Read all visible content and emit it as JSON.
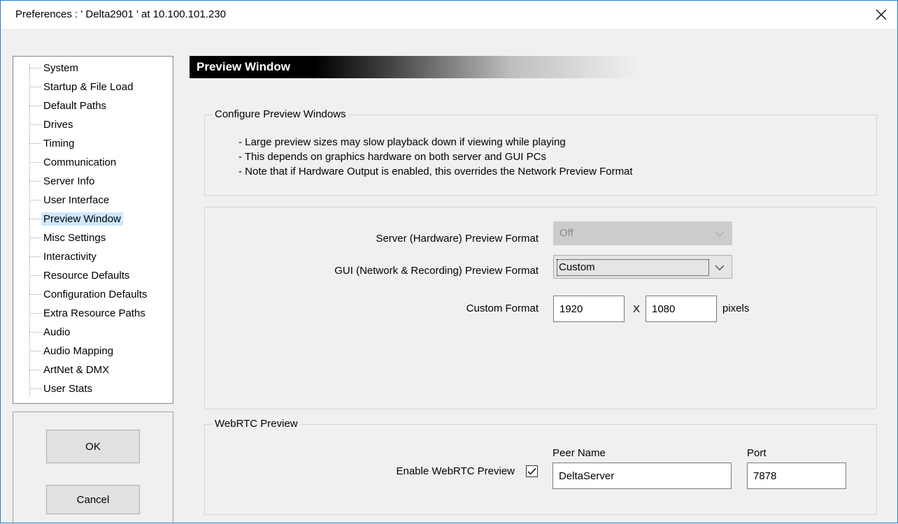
{
  "window": {
    "title": "Preferences  :  ' Delta2901 '  at  10.100.101.230"
  },
  "sidebar": {
    "items": [
      {
        "label": "System"
      },
      {
        "label": "Startup & File Load"
      },
      {
        "label": "Default Paths"
      },
      {
        "label": "Drives"
      },
      {
        "label": "Timing"
      },
      {
        "label": "Communication"
      },
      {
        "label": "Server Info"
      },
      {
        "label": "User Interface"
      },
      {
        "label": "Preview Window",
        "selected": true
      },
      {
        "label": "Misc Settings"
      },
      {
        "label": "Interactivity"
      },
      {
        "label": "Resource Defaults"
      },
      {
        "label": "Configuration Defaults"
      },
      {
        "label": "Extra Resource Paths"
      },
      {
        "label": "Audio"
      },
      {
        "label": "Audio Mapping"
      },
      {
        "label": "ArtNet & DMX"
      },
      {
        "label": "User Stats"
      }
    ]
  },
  "buttons": {
    "ok_label": "OK",
    "cancel_label": "Cancel"
  },
  "page": {
    "header": "Preview Window"
  },
  "configure_group": {
    "legend": "Configure Preview Windows",
    "notes": [
      "- Large preview sizes may slow playback down if viewing while playing",
      "- This depends on graphics hardware on both server and GUI PCs",
      "- Note that if Hardware Output is enabled, this overrides the Network Preview Format"
    ]
  },
  "format_group": {
    "server_label": "Server (Hardware) Preview Format",
    "server_value": "Off",
    "gui_label": "GUI (Network & Recording) Preview Format",
    "gui_value": "Custom",
    "custom_label": "Custom Format",
    "width_value": "1920",
    "x_label": "X",
    "height_value": "1080",
    "units_label": "pixels"
  },
  "webrtc_group": {
    "legend": "WebRTC Preview",
    "enable_label": "Enable WebRTC Preview",
    "enable_checked": true,
    "peer_name_label": "Peer Name",
    "peer_name_value": "DeltaServer",
    "port_label": "Port",
    "port_value": "7878"
  },
  "icons": {
    "close": "close-icon",
    "dropdown": "chevron-down-icon",
    "check": "checkmark-icon"
  }
}
